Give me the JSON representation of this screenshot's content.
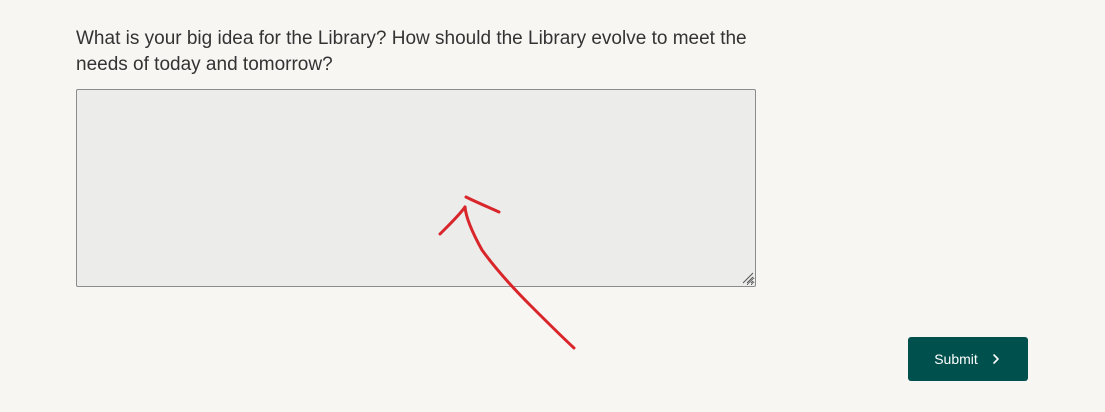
{
  "question": {
    "text": "What is your big idea for the Library? How should the Library evolve to meet the needs of today and tomorrow?"
  },
  "answer": {
    "value": "",
    "placeholder": ""
  },
  "submit": {
    "label": "Submit",
    "icon": "chevron-right-icon",
    "color": "#00504d"
  },
  "annotation": {
    "type": "hand-drawn-arrow",
    "color": "#d9262b"
  }
}
